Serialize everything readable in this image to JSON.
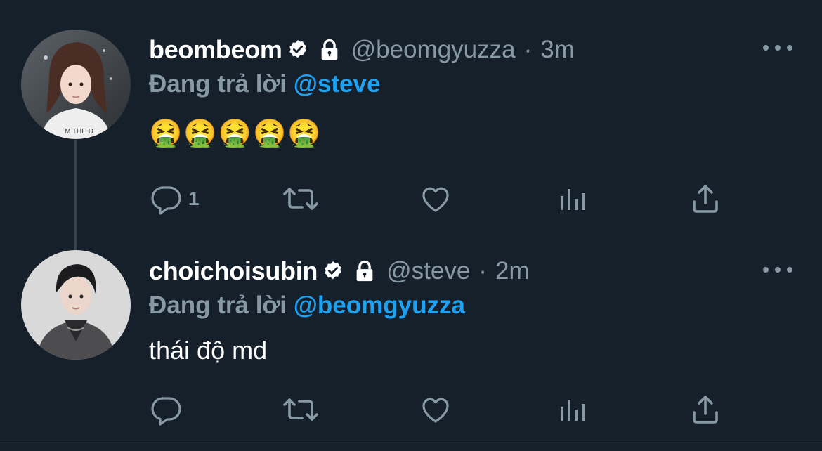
{
  "tweets": [
    {
      "display_name": "beombeom",
      "handle": "@beomgyuzza",
      "separator": "·",
      "time": "3m",
      "reply_prefix": "Đang trả lời",
      "reply_mention": "@steve",
      "content": "🤮🤮🤮🤮🤮",
      "reply_count": "1",
      "verified_icon": "verified-badge-icon",
      "lock_icon": "lock-icon"
    },
    {
      "display_name": "choichoisubin",
      "handle": "@steve",
      "separator": "·",
      "time": "2m",
      "reply_prefix": "Đang trả lời",
      "reply_mention": "@beomgyuzza",
      "content": "thái độ md",
      "reply_count": "",
      "verified_icon": "verified-badge-icon",
      "lock_icon": "lock-icon"
    }
  ],
  "colors": {
    "background": "#15202b",
    "primary_text": "#ffffff",
    "secondary_text": "#8899a6",
    "accent": "#1da1f2",
    "thread_line": "#38444d"
  },
  "icons": {
    "more": "more-horizontal-icon",
    "reply": "reply-bubble-icon",
    "retweet": "retweet-icon",
    "like": "heart-icon",
    "stats": "analytics-icon",
    "share": "share-icon"
  }
}
